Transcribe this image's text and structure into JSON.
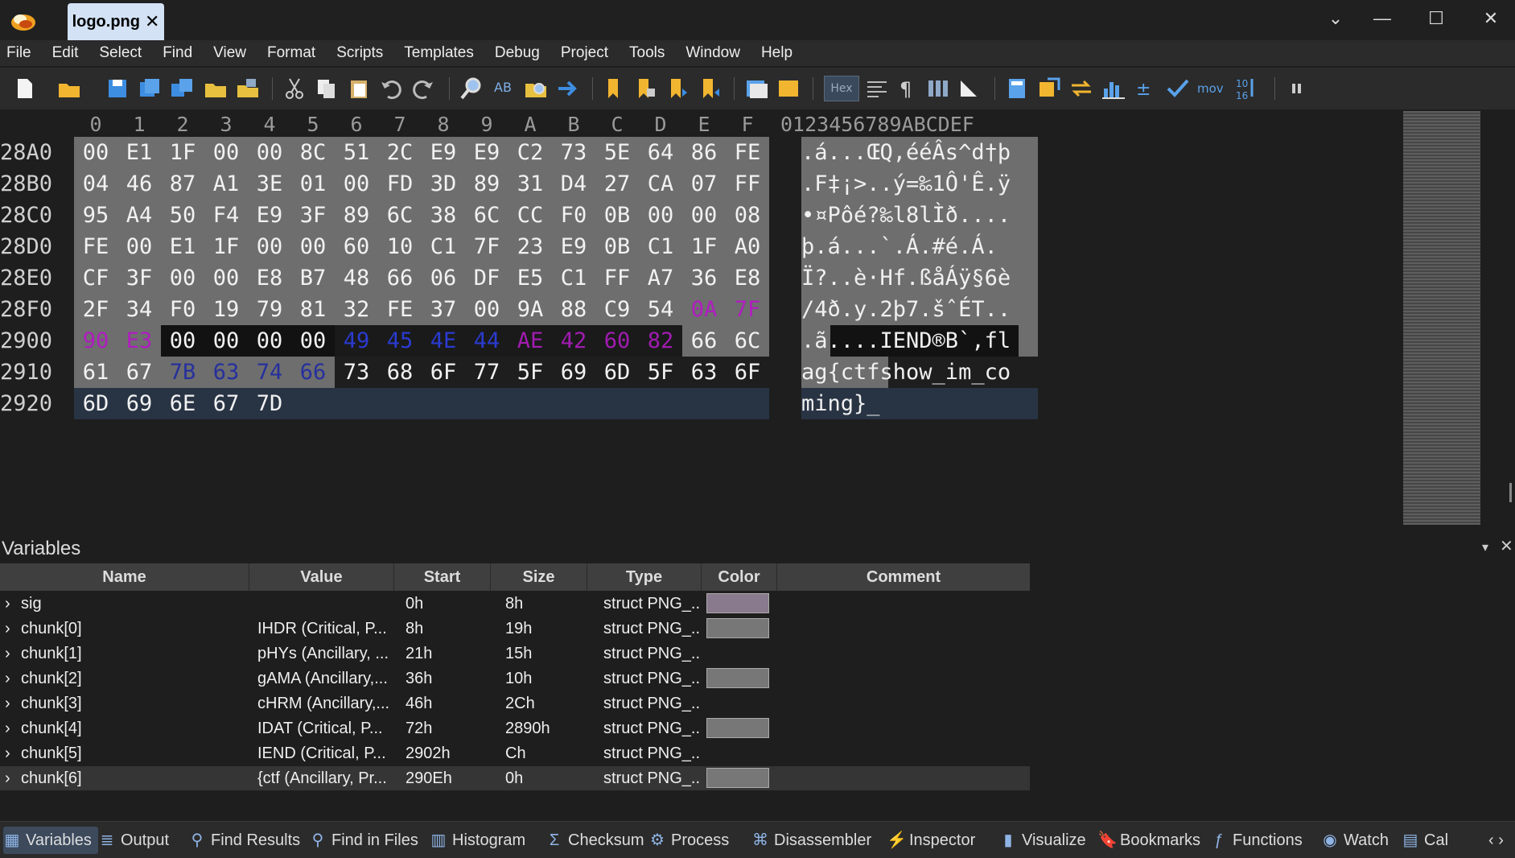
{
  "title_bar": {
    "tab": "logo.png",
    "tab_close": "✕",
    "dropdown": "⌄",
    "minimize": "—",
    "maximize": "☐",
    "close": "✕"
  },
  "menu": [
    "File",
    "Edit",
    "Select",
    "Find",
    "View",
    "Format",
    "Scripts",
    "Templates",
    "Debug",
    "Project",
    "Tools",
    "Window",
    "Help"
  ],
  "toolbar": {
    "hex_toggle": "Hex",
    "mov_label": "mov"
  },
  "hex": {
    "column_headers": [
      "0",
      "1",
      "2",
      "3",
      "4",
      "5",
      "6",
      "7",
      "8",
      "9",
      "A",
      "B",
      "C",
      "D",
      "E",
      "F"
    ],
    "ascii_header": "0123456789ABCDEF",
    "rows": [
      {
        "addr": "28A0",
        "bytes": [
          "00",
          "E1",
          "1F",
          "00",
          "00",
          "8C",
          "51",
          "2C",
          "E9",
          "E9",
          "C2",
          "73",
          "5E",
          "64",
          "86",
          "FE"
        ],
        "ascii": ".á...ŒQ,ééÂs^d†þ"
      },
      {
        "addr": "28B0",
        "bytes": [
          "04",
          "46",
          "87",
          "A1",
          "3E",
          "01",
          "00",
          "FD",
          "3D",
          "89",
          "31",
          "D4",
          "27",
          "CA",
          "07",
          "FF"
        ],
        "ascii": ".F‡¡>..ý=‰1Ô'Ê.ÿ"
      },
      {
        "addr": "28C0",
        "bytes": [
          "95",
          "A4",
          "50",
          "F4",
          "E9",
          "3F",
          "89",
          "6C",
          "38",
          "6C",
          "CC",
          "F0",
          "0B",
          "00",
          "00",
          "08"
        ],
        "ascii": "•¤Pôé?‰l8lÌð...."
      },
      {
        "addr": "28D0",
        "bytes": [
          "FE",
          "00",
          "E1",
          "1F",
          "00",
          "00",
          "60",
          "10",
          "C1",
          "7F",
          "23",
          "E9",
          "0B",
          "C1",
          "1F",
          "A0"
        ],
        "ascii": "þ.á...`.Á.#é.Á. "
      },
      {
        "addr": "28E0",
        "bytes": [
          "CF",
          "3F",
          "00",
          "00",
          "E8",
          "B7",
          "48",
          "66",
          "06",
          "DF",
          "E5",
          "C1",
          "FF",
          "A7",
          "36",
          "E8"
        ],
        "ascii": "Ï?..è·Hf.ßåÁÿ§6è"
      },
      {
        "addr": "28F0",
        "bytes": [
          "2F",
          "34",
          "F0",
          "19",
          "79",
          "81",
          "32",
          "FE",
          "37",
          "00",
          "9A",
          "88",
          "C9",
          "54",
          "0A",
          "7F"
        ],
        "ascii": "/4ð.y.2þ7.šˆÉT.."
      },
      {
        "addr": "2900",
        "bytes": [
          "90",
          "E3",
          "00",
          "00",
          "00",
          "00",
          "49",
          "45",
          "4E",
          "44",
          "AE",
          "42",
          "60",
          "82",
          "66",
          "6C"
        ],
        "ascii": ".ã....IEND®B`‚fl"
      },
      {
        "addr": "2910",
        "bytes": [
          "61",
          "67",
          "7B",
          "63",
          "74",
          "66",
          "73",
          "68",
          "6F",
          "77",
          "5F",
          "69",
          "6D",
          "5F",
          "63",
          "6F"
        ],
        "ascii": "ag{ctfshow_im_co"
      },
      {
        "addr": "2920",
        "bytes": [
          "6D",
          "69",
          "6E",
          "67",
          "7D"
        ],
        "ascii": "ming}_"
      }
    ]
  },
  "variables": {
    "title": "Variables",
    "columns": [
      "Name",
      "Value",
      "Start",
      "Size",
      "Type",
      "Color",
      "Comment"
    ],
    "rows": [
      {
        "name": "sig",
        "value": "",
        "start": "0h",
        "size": "8h",
        "type": "struct PNG_...",
        "swatch": "#8a7a8e"
      },
      {
        "name": "chunk[0]",
        "value": "IHDR  (Critical, P...",
        "start": "8h",
        "size": "19h",
        "type": "struct PNG_...",
        "swatch": "#777777"
      },
      {
        "name": "chunk[1]",
        "value": "pHYs  (Ancillary, ...",
        "start": "21h",
        "size": "15h",
        "type": "struct PNG_...",
        "swatch": ""
      },
      {
        "name": "chunk[2]",
        "value": "gAMA  (Ancillary,...",
        "start": "36h",
        "size": "10h",
        "type": "struct PNG_...",
        "swatch": "#777777"
      },
      {
        "name": "chunk[3]",
        "value": "cHRM  (Ancillary,...",
        "start": "46h",
        "size": "2Ch",
        "type": "struct PNG_...",
        "swatch": ""
      },
      {
        "name": "chunk[4]",
        "value": "IDAT  (Critical, P...",
        "start": "72h",
        "size": "2890h",
        "type": "struct PNG_...",
        "swatch": "#777777"
      },
      {
        "name": "chunk[5]",
        "value": "IEND  (Critical, P...",
        "start": "2902h",
        "size": "Ch",
        "type": "struct PNG_...",
        "swatch": ""
      },
      {
        "name": "chunk[6]",
        "value": "{ctf  (Ancillary, Pr...",
        "start": "290Eh",
        "size": "0h",
        "type": "struct PNG_...",
        "swatch": "#777777"
      }
    ]
  },
  "bottom_tabs": [
    {
      "label": "Variables",
      "icon": "variables-icon",
      "active": true
    },
    {
      "label": "Output",
      "icon": "output-icon"
    },
    {
      "label": "Find Results",
      "icon": "find-results-icon"
    },
    {
      "label": "Find in Files",
      "icon": "find-in-files-icon"
    },
    {
      "label": "Histogram",
      "icon": "histogram-icon"
    },
    {
      "label": "Checksum",
      "icon": "checksum-icon"
    },
    {
      "label": "Process",
      "icon": "process-icon"
    },
    {
      "label": "Disassembler",
      "icon": "disassembler-icon"
    },
    {
      "label": "Inspector",
      "icon": "inspector-icon"
    },
    {
      "label": "Visualize",
      "icon": "visualize-icon"
    },
    {
      "label": "Bookmarks",
      "icon": "bookmarks-icon"
    },
    {
      "label": "Functions",
      "icon": "functions-icon"
    },
    {
      "label": "Watch",
      "icon": "watch-icon"
    },
    {
      "label": "Cal",
      "icon": "calculator-icon"
    }
  ]
}
